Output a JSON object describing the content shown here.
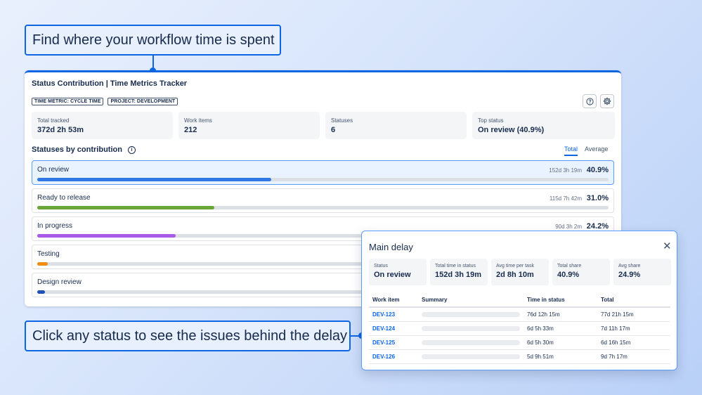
{
  "callouts": {
    "top": "Find where your workflow time is spent",
    "bottom": "Click any status to see the issues behind the delay"
  },
  "panel": {
    "title": "Status Contribution | Time Metrics Tracker",
    "tags": [
      "TIME METRIC: CYCLE TIME",
      "PROJECT: DEVELOPMENT"
    ],
    "icons": [
      "help-icon",
      "gear-icon"
    ]
  },
  "stats": [
    {
      "label": "Total tracked",
      "value": "372d 2h 53m"
    },
    {
      "label": "Work items",
      "value": "212"
    },
    {
      "label": "Statuses",
      "value": "6"
    },
    {
      "label": "Top status",
      "value": "On review (40.9%)"
    }
  ],
  "section": {
    "title": "Statuses by contribution",
    "tabs": [
      "Total",
      "Average"
    ],
    "active_tab": "Total"
  },
  "statuses": [
    {
      "name": "On review",
      "duration": "152d 3h 19m",
      "percent": "40.9%",
      "fill": 0.409,
      "color": "#2f77e4",
      "selected": true
    },
    {
      "name": "Ready to release",
      "duration": "115d 7h 42m",
      "percent": "31.0%",
      "fill": 0.31,
      "color": "#6aa637"
    },
    {
      "name": "In progress",
      "duration": "90d 3h 2m",
      "percent": "24.2%",
      "fill": 0.242,
      "color": "#a75ae8"
    },
    {
      "name": "Testing",
      "duration": "",
      "percent": "",
      "fill": 0.018,
      "color": "#f18d13"
    },
    {
      "name": "Design review",
      "duration": "",
      "percent": "",
      "fill": 0.013,
      "color": "#1f50b8"
    }
  ],
  "popup": {
    "title": "Main delay",
    "stats": [
      {
        "label": "Status",
        "value": "On review"
      },
      {
        "label": "Total time in status",
        "value": "152d 3h 19m"
      },
      {
        "label": "Avg time per task",
        "value": "2d 8h 10m"
      },
      {
        "label": "Total share",
        "value": "40.9%"
      },
      {
        "label": "Avg share",
        "value": "24.9%"
      }
    ],
    "columns": [
      "Work item",
      "Summary",
      "Time in status",
      "Total"
    ],
    "rows": [
      {
        "key": "DEV-123",
        "time": "76d 12h 15m",
        "total": "77d 21h 15m"
      },
      {
        "key": "DEV-124",
        "time": "6d 5h 33m",
        "total": "7d 11h 17m"
      },
      {
        "key": "DEV-125",
        "time": "6d 5h 30m",
        "total": "6d 16h 15m"
      },
      {
        "key": "DEV-126",
        "time": "5d 9h 51m",
        "total": "9d 7h 17m"
      }
    ]
  }
}
